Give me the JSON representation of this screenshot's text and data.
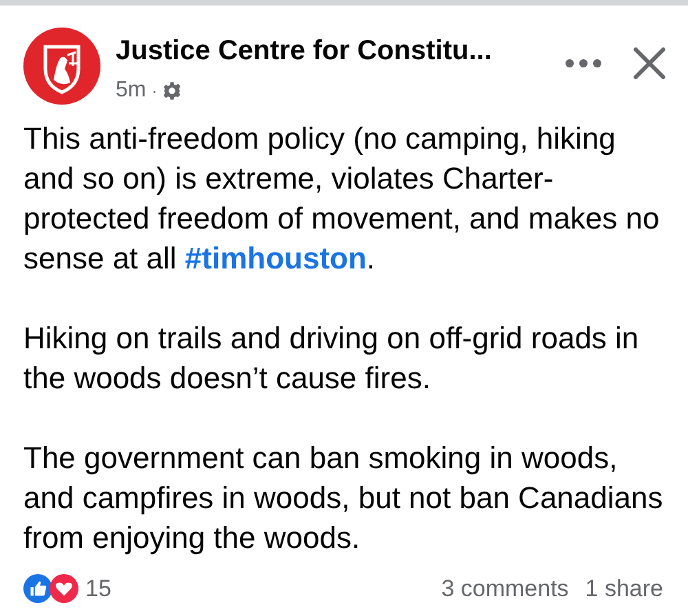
{
  "post": {
    "author": "Justice Centre for Constitu...",
    "time": "5m",
    "separator": "·",
    "paragraphs": [
      {
        "before": "This anti-freedom policy (no camping, hiking and so on) is extreme, violates Charter-protected freedom of movement, and makes no sense at all ",
        "hashtag": "#timhouston",
        "after": "."
      },
      {
        "before": "Hiking on trails and driving on off-grid roads in the woods doesn’t cause fires."
      },
      {
        "before": "The government can ban smoking in woods, and campfires in woods, but not ban Canadians from enjoying the woods."
      }
    ]
  },
  "footer": {
    "reactions": "15",
    "comments": "3 comments",
    "shares": "1 share"
  }
}
